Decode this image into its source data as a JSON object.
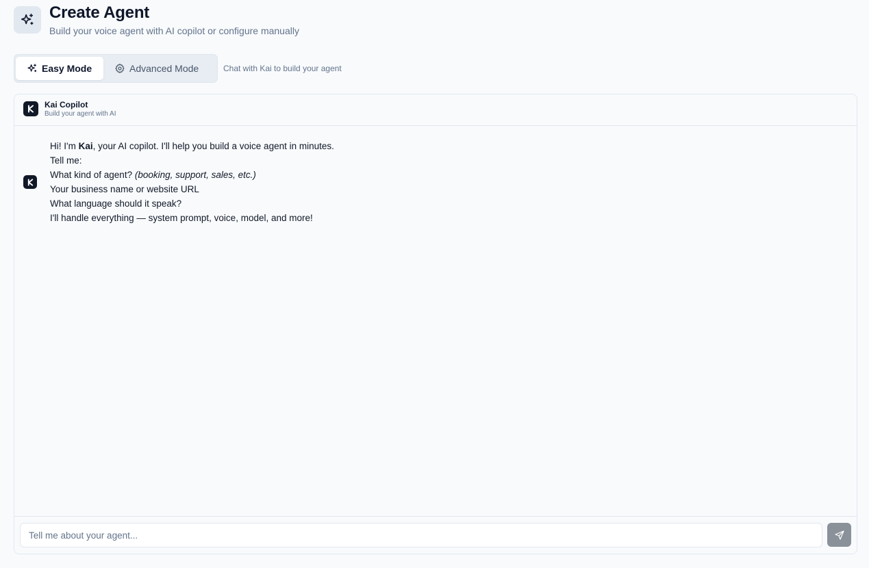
{
  "header": {
    "title": "Create Agent",
    "subtitle": "Build your voice agent with AI copilot or configure manually",
    "icon": "sparkles-icon"
  },
  "modes": {
    "easy_label": "Easy Mode",
    "advanced_label": "Advanced Mode",
    "selected": "Easy Mode",
    "hint": "Chat with Kai to build your agent"
  },
  "copilot": {
    "logo": "K",
    "name": "Kai Copilot",
    "subtitle": "Build your agent with AI"
  },
  "message": {
    "greeting_prefix": "Hi! I'm ",
    "greeting_name": "Kai",
    "greeting_suffix": ", your AI copilot. I'll help you build a voice agent in minutes.",
    "tell_me": "Tell me:",
    "q1_prefix": "What kind of agent? ",
    "q1_examples": "(booking, support, sales, etc.)",
    "q2": "Your business name or website URL",
    "q3": "What language should it speak?",
    "closing": "I'll handle everything — system prompt, voice, model, and more!"
  },
  "composer": {
    "placeholder": "Tell me about your agent...",
    "send_icon": "send-icon"
  },
  "colors": {
    "background": "#f8fafc",
    "text": "#0f172a",
    "muted": "#64748b",
    "logo_bg": "#111827",
    "send_button": "#8a9199"
  }
}
